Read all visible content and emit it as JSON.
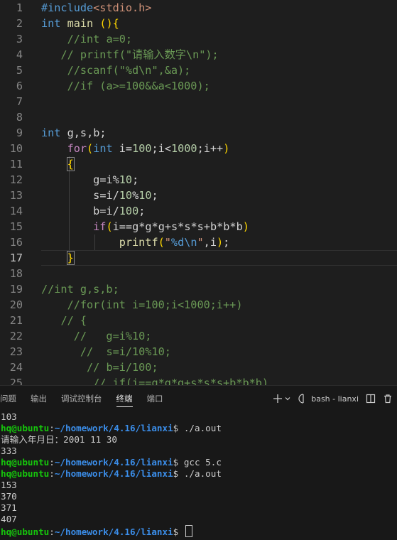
{
  "editor": {
    "lines": [
      {
        "n": "1",
        "text": "#include<stdio.h>"
      },
      {
        "n": "2",
        "text": "int main (){"
      },
      {
        "n": "3",
        "text": "    //int a=0;"
      },
      {
        "n": "4",
        "text": "   // printf(\"请输入数字\\n\");"
      },
      {
        "n": "5",
        "text": "    //scanf(\"%d\\n\",&a);"
      },
      {
        "n": "6",
        "text": "    //if (a>=100&&a<1000);"
      },
      {
        "n": "7",
        "text": ""
      },
      {
        "n": "8",
        "text": ""
      },
      {
        "n": "9",
        "text": "int g,s,b;"
      },
      {
        "n": "10",
        "text": "    for(int i=100;i<1000;i++)"
      },
      {
        "n": "11",
        "text": "    {"
      },
      {
        "n": "12",
        "text": "        g=i%10;"
      },
      {
        "n": "13",
        "text": "        s=i/10%10;"
      },
      {
        "n": "14",
        "text": "        b=i/100;"
      },
      {
        "n": "15",
        "text": "        if(i==g*g*g+s*s*s+b*b*b)"
      },
      {
        "n": "16",
        "text": "            printf(\"%d\\n\",i);"
      },
      {
        "n": "17",
        "text": "    }"
      },
      {
        "n": "18",
        "text": ""
      },
      {
        "n": "19",
        "text": "//int g,s,b;"
      },
      {
        "n": "20",
        "text": "    //for(int i=100;i<1000;i++)"
      },
      {
        "n": "21",
        "text": "   // {"
      },
      {
        "n": "22",
        "text": "     //   g=i%10;"
      },
      {
        "n": "23",
        "text": "      //  s=i/10%10;"
      },
      {
        "n": "24",
        "text": "       // b=i/100;"
      },
      {
        "n": "25",
        "text": "        // if(i==g*g*g+s*s*s+b*b*b)"
      }
    ]
  },
  "panel": {
    "tabs": [
      "问题",
      "输出",
      "调试控制台",
      "终端",
      "端口"
    ],
    "active_tab": "终端",
    "terminal_name": "bash - lianxi",
    "icons": [
      "plus-icon",
      "chevron-down-icon",
      "terminal-icon",
      "split-icon",
      "trash-icon"
    ]
  },
  "terminal": {
    "user": "hq@ubuntu",
    "path": "~/homework/4.16/lianxi",
    "lines": [
      {
        "type": "out",
        "text": "103"
      },
      {
        "type": "cmd",
        "cmd": " ./a.out"
      },
      {
        "type": "out",
        "text": "请输入年月日：2001 11 30"
      },
      {
        "type": "out",
        "text": "333"
      },
      {
        "type": "cmd",
        "cmd": " gcc 5.c"
      },
      {
        "type": "cmd",
        "cmd": " ./a.out"
      },
      {
        "type": "out",
        "text": "153"
      },
      {
        "type": "out",
        "text": "370"
      },
      {
        "type": "out",
        "text": "371"
      },
      {
        "type": "out",
        "text": "407"
      },
      {
        "type": "cmd",
        "cmd": " "
      }
    ]
  },
  "colors": {
    "background": "#1e1e1e",
    "prompt_user": "#16c60c",
    "prompt_path": "#3b8eea"
  }
}
